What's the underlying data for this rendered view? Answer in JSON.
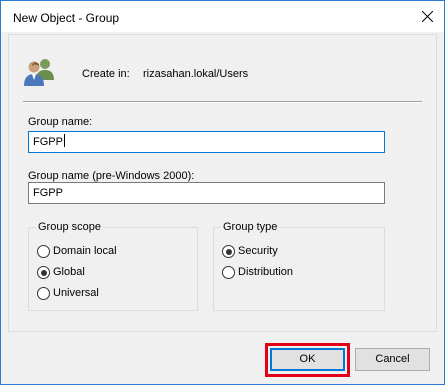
{
  "window": {
    "title": "New Object - Group"
  },
  "header": {
    "create_in_label": "Create in:",
    "create_in_value": "rizasahan.lokal/Users",
    "icon": "group-users-icon"
  },
  "form": {
    "group_name_label": "Group name:",
    "group_name_value": "FGPP",
    "group_name_pre2000_label": "Group name (pre-Windows 2000):",
    "group_name_pre2000_value": "FGPP"
  },
  "group_scope": {
    "title": "Group scope",
    "options": [
      "Domain local",
      "Global",
      "Universal"
    ],
    "selected": "Global"
  },
  "group_type": {
    "title": "Group type",
    "options": [
      "Security",
      "Distribution"
    ],
    "selected": "Security"
  },
  "buttons": {
    "ok": "OK",
    "cancel": "Cancel"
  },
  "colors": {
    "highlight": "#e3001b",
    "accent": "#0078d7"
  }
}
